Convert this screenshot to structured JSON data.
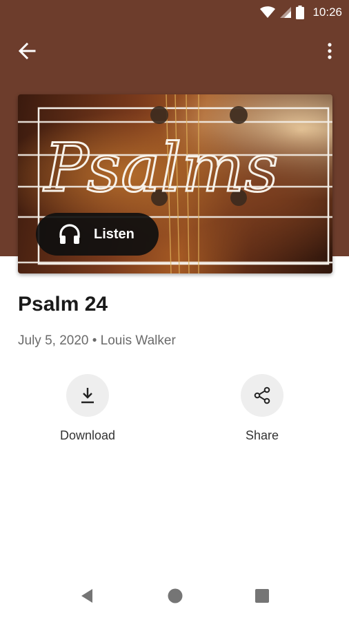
{
  "status_bar": {
    "time": "10:26"
  },
  "toolbar": {
    "back_icon": "arrow-left-icon",
    "menu_icon": "more-vert-icon"
  },
  "artwork": {
    "script_text": "Psalms",
    "listen_label": "Listen",
    "listen_icon": "headphones-icon"
  },
  "sermon": {
    "title": "Psalm 24",
    "subtitle": "July 5, 2020 • Louis Walker"
  },
  "actions": [
    {
      "label": "Download",
      "icon": "download-icon"
    },
    {
      "label": "Share",
      "icon": "share-icon"
    }
  ],
  "colors": {
    "header": "#6d3d2c",
    "action_circle": "#eeeeee",
    "listen_button": "#0f0f0f"
  }
}
